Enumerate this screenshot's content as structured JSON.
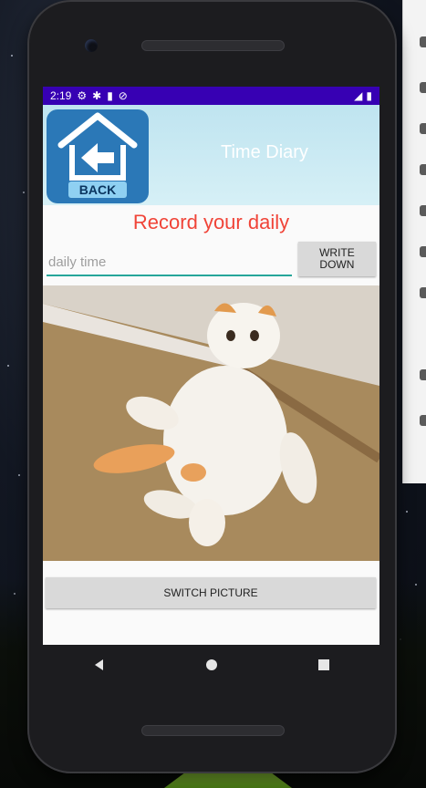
{
  "status": {
    "time": "2:19"
  },
  "toolbar": {
    "back_label": "BACK",
    "title": "Time Diary"
  },
  "main": {
    "heading": "Record your daily",
    "input_placeholder": "daily time",
    "write_button": "WRITE DOWN",
    "switch_button": "SWITCH PICTURE"
  },
  "icons": [
    "settings-icon",
    "wifi-icon",
    "sd-card-icon",
    "sync-icon",
    "signal-icon",
    "battery-icon",
    "back-icon",
    "home-icon",
    "recents-icon"
  ],
  "colors": {
    "statusbar": "#3700b3",
    "heading": "#f04438",
    "accent": "#26a69a"
  }
}
